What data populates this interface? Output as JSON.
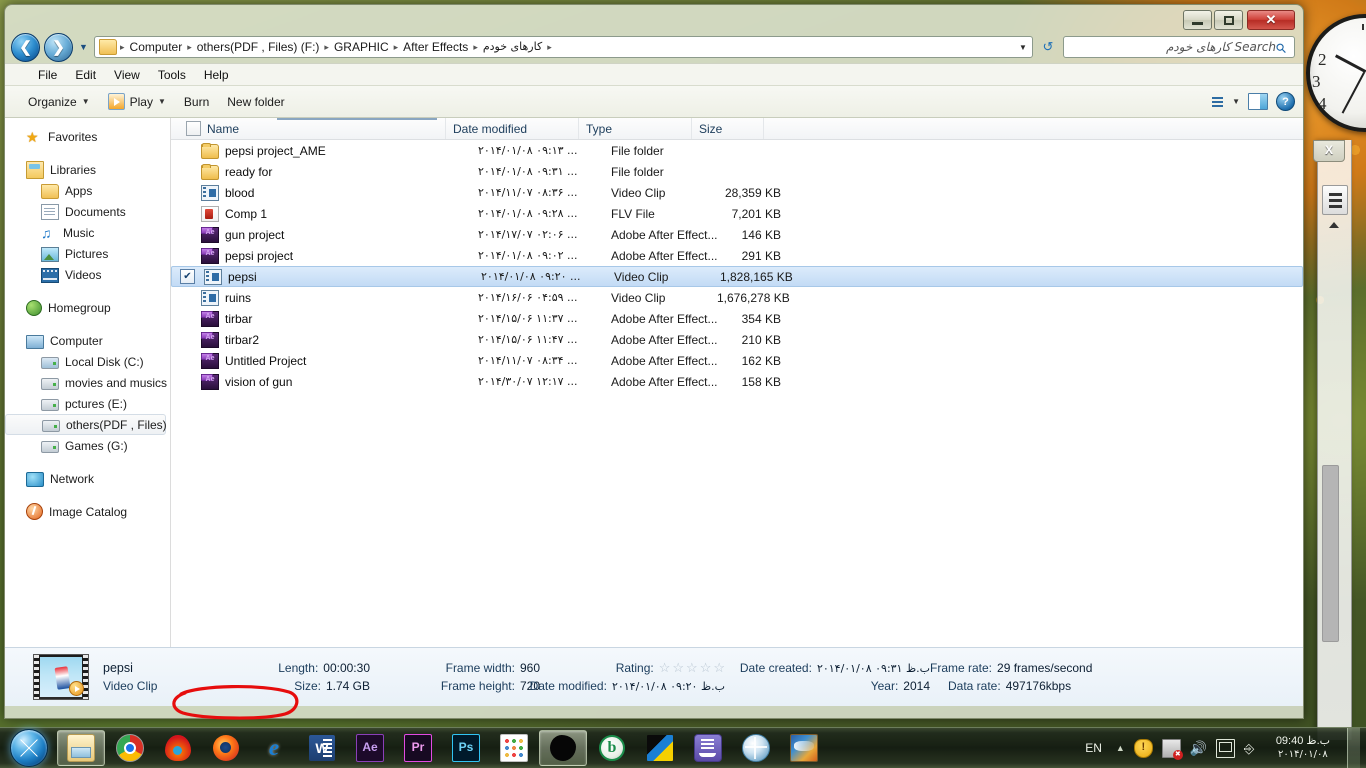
{
  "window": {
    "controls": {
      "minimize": "–",
      "maximize": "❐",
      "close": "✕"
    }
  },
  "address": {
    "back_icon": "back-arrow",
    "forward_icon": "forward-arrow",
    "history_icon": "chevron-down",
    "refresh_icon": "refresh",
    "crumbs": [
      "Computer",
      "others(PDF , Files) (F:)",
      "GRAPHIC",
      "After Effects",
      "کارهای خودم"
    ],
    "separator": "▶"
  },
  "search": {
    "placeholder": "Search کارهای خودم",
    "icon": "search-icon"
  },
  "menubar": {
    "items": [
      "File",
      "Edit",
      "View",
      "Tools",
      "Help"
    ]
  },
  "toolbar": {
    "organize": "Organize",
    "play": "Play",
    "burn": "Burn",
    "new_folder": "New folder",
    "caret": "▼",
    "view_icon": "view-list-icon",
    "preview_icon": "preview-pane-icon",
    "help_icon": "help-icon",
    "help_glyph": "?"
  },
  "navpane": {
    "groups": [
      {
        "header": {
          "label": "Favorites",
          "icon": "star-icon"
        },
        "children": []
      },
      {
        "header": {
          "label": "Libraries",
          "icon": "libraries-icon"
        },
        "children": [
          {
            "label": "Apps",
            "icon": "folder-icon"
          },
          {
            "label": "Documents",
            "icon": "document-icon"
          },
          {
            "label": "Music",
            "icon": "music-icon"
          },
          {
            "label": "Pictures",
            "icon": "pictures-icon"
          },
          {
            "label": "Videos",
            "icon": "videos-icon"
          }
        ]
      },
      {
        "header": {
          "label": "Homegroup",
          "icon": "homegroup-icon"
        },
        "children": []
      },
      {
        "header": {
          "label": "Computer",
          "icon": "computer-icon"
        },
        "children": [
          {
            "label": "Local Disk (C:)",
            "icon": "local-disk-icon"
          },
          {
            "label": "movies and musics (",
            "icon": "drive-icon"
          },
          {
            "label": "pctures (E:)",
            "icon": "drive-icon"
          },
          {
            "label": "others(PDF , Files) (F",
            "icon": "drive-icon",
            "selected": true
          },
          {
            "label": "Games (G:)",
            "icon": "drive-icon"
          }
        ]
      },
      {
        "header": {
          "label": "Network",
          "icon": "network-icon"
        },
        "children": []
      },
      {
        "header": {
          "label": "Image Catalog",
          "icon": "image-catalog-icon"
        },
        "children": []
      }
    ]
  },
  "filelist": {
    "columns": [
      "Name",
      "Date modified",
      "Type",
      "Size"
    ],
    "select_all_checkbox": false,
    "sorted_column": "Name",
    "rows": [
      {
        "name": "pepsi project_AME",
        "date": "۲۰۱۴/۰۱/۰۸ ۰۹:۱۳ ...",
        "type": "File folder",
        "size": "",
        "icon": "folder-icon",
        "checked": false,
        "selected": false
      },
      {
        "name": "ready for",
        "date": "۲۰۱۴/۰۱/۰۸ ۰۹:۳۱ ...",
        "type": "File folder",
        "size": "",
        "icon": "folder-icon",
        "checked": false,
        "selected": false
      },
      {
        "name": "blood",
        "date": "۲۰۱۴/۱۱/۰۷ ۰۸:۳۶ ...",
        "type": "Video Clip",
        "size": "28,359 KB",
        "icon": "video-icon",
        "checked": false,
        "selected": false
      },
      {
        "name": "Comp 1",
        "date": "۲۰۱۴/۰۱/۰۸ ۰۹:۲۸ ...",
        "type": "FLV File",
        "size": "7,201 KB",
        "icon": "flv-icon",
        "checked": false,
        "selected": false
      },
      {
        "name": "gun project",
        "date": "۲۰۱۴/۱۷/۰۷ ۰۲:۰۶ ...",
        "type": "Adobe After Effect...",
        "size": "146 KB",
        "icon": "after-effects-icon",
        "checked": false,
        "selected": false
      },
      {
        "name": "pepsi project",
        "date": "۲۰۱۴/۰۱/۰۸ ۰۹:۰۲ ...",
        "type": "Adobe After Effect...",
        "size": "291 KB",
        "icon": "after-effects-icon",
        "checked": false,
        "selected": false
      },
      {
        "name": "pepsi",
        "date": "۲۰۱۴/۰۱/۰۸ ۰۹:۲۰ ...",
        "type": "Video Clip",
        "size": "1,828,165 KB",
        "icon": "video-icon",
        "checked": true,
        "selected": true
      },
      {
        "name": "ruins",
        "date": "۲۰۱۴/۱۶/۰۶ ۰۴:۵۹ ...",
        "type": "Video Clip",
        "size": "1,676,278 KB",
        "icon": "video-icon",
        "checked": false,
        "selected": false
      },
      {
        "name": "tirbar",
        "date": "۲۰۱۴/۱۵/۰۶ ۱۱:۳۷ ...",
        "type": "Adobe After Effect...",
        "size": "354 KB",
        "icon": "after-effects-icon",
        "checked": false,
        "selected": false
      },
      {
        "name": "tirbar2",
        "date": "۲۰۱۴/۱۵/۰۶ ۱۱:۴۷ ...",
        "type": "Adobe After Effect...",
        "size": "210 KB",
        "icon": "after-effects-icon",
        "checked": false,
        "selected": false
      },
      {
        "name": "Untitled Project",
        "date": "۲۰۱۴/۱۱/۰۷ ۰۸:۳۴ ...",
        "type": "Adobe After Effect...",
        "size": "162 KB",
        "icon": "after-effects-icon",
        "checked": false,
        "selected": false
      },
      {
        "name": "vision of gun",
        "date": "۲۰۱۴/۳۰/۰۷ ۱۲:۱۷ ...",
        "type": "Adobe After Effect...",
        "size": "158 KB",
        "icon": "after-effects-icon",
        "checked": false,
        "selected": false
      }
    ]
  },
  "details": {
    "thumbnail_icon": "video-thumbnail",
    "file_name": "pepsi",
    "file_kind": "Video Clip",
    "length_label": "Length:",
    "length_value": "00:00:30",
    "size_label": "Size:",
    "size_value": "1.74 GB",
    "frame_width_label": "Frame width:",
    "frame_width_value": "960",
    "frame_height_label": "Frame height:",
    "frame_height_value": "720",
    "rating_label": "Rating:",
    "rating_stars": "☆ ☆ ☆ ☆ ☆",
    "date_modified_label": "Date modified:",
    "date_modified_value": "۲۰۱۴/۰۱/۰۸ ب.ظ ۰۹:۲۰",
    "date_created_label": "Date created:",
    "date_created_value": "۲۰۱۴/۰۱/۰۸ ب.ظ ۰۹:۳۱",
    "year_label": "Year:",
    "year_value": "2014",
    "frame_rate_label": "Frame rate:",
    "frame_rate_value": "29 frames/second",
    "data_rate_label": "Data rate:",
    "data_rate_value": "497176kbps",
    "annotation_color": "#e01010",
    "annotation_shape": "hand-drawn-ellipse"
  },
  "gadgets": {
    "clock_numbers": [
      "2",
      "3",
      "4"
    ],
    "sidebar_close": "X",
    "sidebar_menu_icon": "hamburger-icon",
    "sidebar_up_icon": "chevron-up-icon"
  },
  "taskbar": {
    "start_icon": "windows-start-orb",
    "buttons": [
      {
        "name": "windows-explorer",
        "icon": "explorer-icon",
        "active": true
      },
      {
        "name": "google-chrome",
        "icon": "chrome-icon",
        "active": false
      },
      {
        "name": "maxthon",
        "icon": "flame-icon",
        "active": false
      },
      {
        "name": "mozilla-firefox",
        "icon": "firefox-icon",
        "active": false
      },
      {
        "name": "internet-explorer",
        "icon": "ie-icon",
        "glyph": "e",
        "active": false
      },
      {
        "name": "microsoft-word",
        "icon": "word-icon",
        "glyph": "W",
        "active": false
      },
      {
        "name": "adobe-after-effects",
        "icon": "after-effects-icon",
        "glyph": "Ae",
        "active": false
      },
      {
        "name": "adobe-premiere",
        "icon": "premiere-icon",
        "glyph": "Pr",
        "active": false
      },
      {
        "name": "adobe-photoshop",
        "icon": "photoshop-icon",
        "glyph": "Ps",
        "active": false
      },
      {
        "name": "app-grid",
        "icon": "grid-icon",
        "active": false
      },
      {
        "name": "black-blob-app",
        "icon": "blob-icon",
        "active": true
      },
      {
        "name": "bitcomet",
        "icon": "bitcomet-icon",
        "glyph": "b",
        "active": false
      },
      {
        "name": "flag-app",
        "icon": "flag-icon",
        "active": false
      },
      {
        "name": "ship-app",
        "icon": "ship-icon",
        "active": false
      },
      {
        "name": "globe-app",
        "icon": "globe-icon",
        "active": false
      },
      {
        "name": "farsi-app",
        "icon": "farsi-icon",
        "active": false
      }
    ],
    "language": "EN",
    "tray_expand_icon": "chevron-up-icon",
    "tray": [
      {
        "name": "action-center-icon",
        "glyph": "!"
      },
      {
        "name": "network-icon",
        "glyph": ""
      },
      {
        "name": "volume-icon",
        "glyph": "🔊"
      },
      {
        "name": "display-icon",
        "glyph": ""
      },
      {
        "name": "device-icon",
        "glyph": ""
      }
    ],
    "clock_time": "09:40 ب.ظ",
    "clock_date": "۲۰۱۴/۰۱/۰۸",
    "show_desktop": "show-desktop-button"
  }
}
